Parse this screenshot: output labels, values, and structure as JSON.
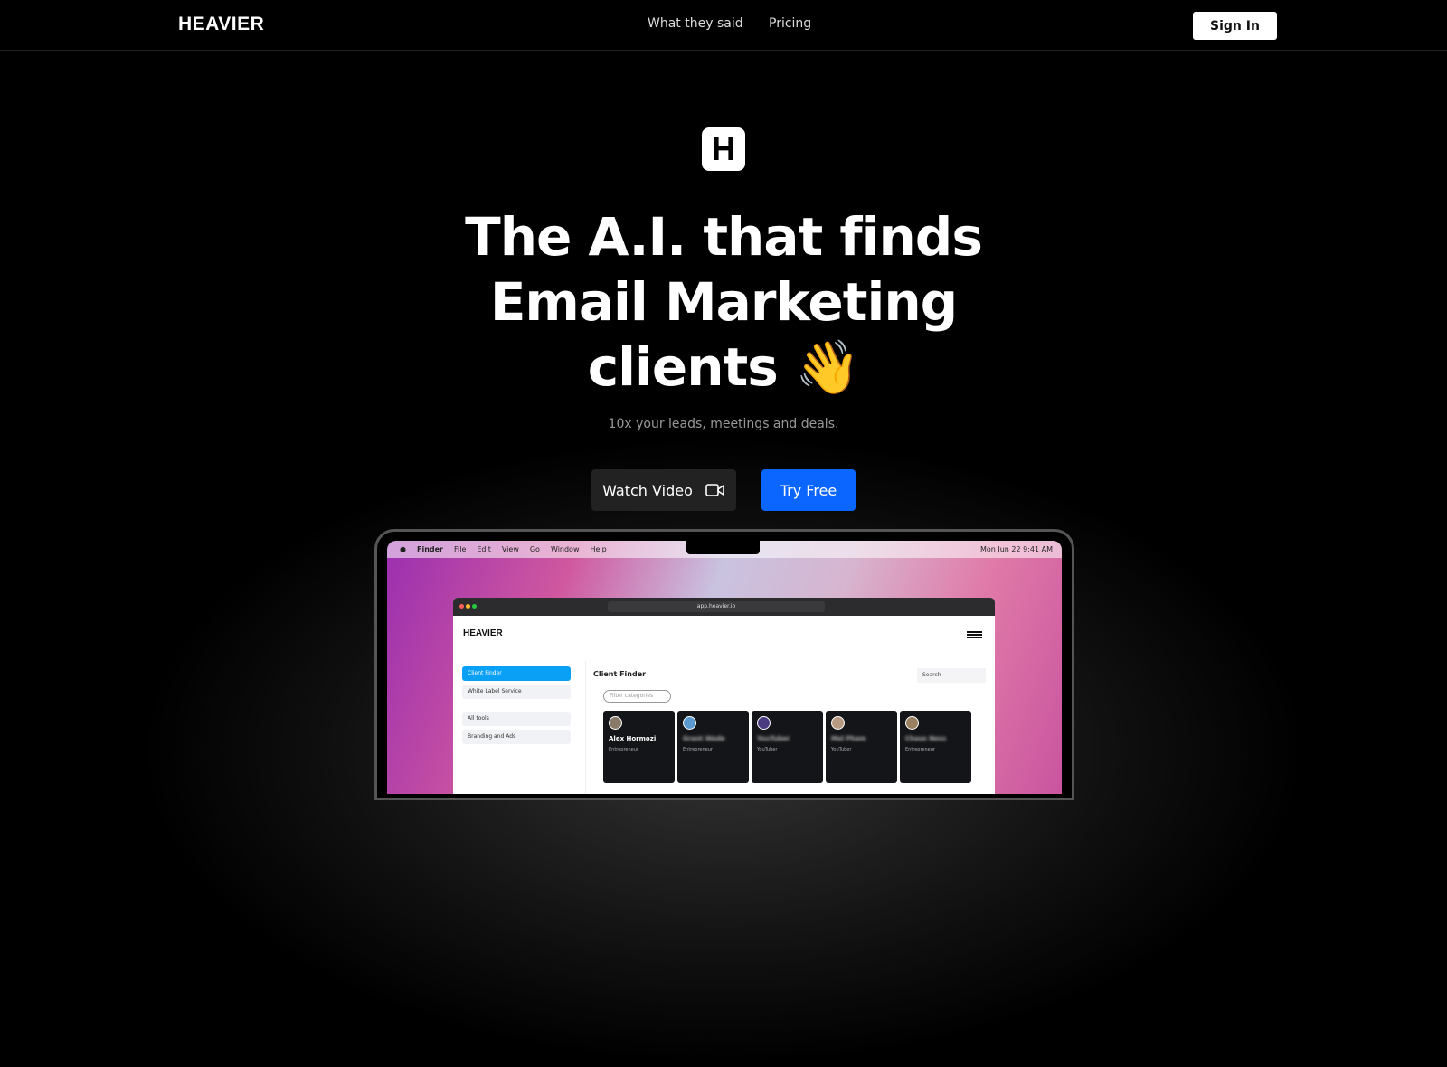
{
  "nav": {
    "logo": "HEAVIER",
    "links": [
      "What they said",
      "Pricing"
    ],
    "signin": "Sign In"
  },
  "hero": {
    "logo_letter": "H",
    "headline_line1": "The A.I. that finds",
    "headline_line2": "Email Marketing",
    "headline_line3": "clients 👋",
    "subtitle": "10x your leads, meetings and deals.",
    "watch_video": "Watch Video",
    "try_free": "Try Free"
  },
  "mockup": {
    "menubar": [
      "Finder",
      "File",
      "Edit",
      "View",
      "Go",
      "Window",
      "Help"
    ],
    "clock": "Mon Jun 22  9:41 AM",
    "url": "app.heavier.io",
    "app_logo": "HEAVIER",
    "sidebar": [
      "Client Finder",
      "White Label Service",
      "All tools",
      "Branding and Ads"
    ],
    "title": "Client Finder",
    "search": "Search",
    "filter": "Filter categories",
    "cards": [
      {
        "name": "Alex Hormozi",
        "role": "Entrepreneur"
      },
      {
        "name": "Grant Wade",
        "role": "Entrepreneur"
      },
      {
        "name": "YouTuber",
        "role": "YouTuber"
      },
      {
        "name": "Mel Pham",
        "role": "YouTuber"
      },
      {
        "name": "Chase Ness",
        "role": "Entrepreneur"
      }
    ]
  }
}
